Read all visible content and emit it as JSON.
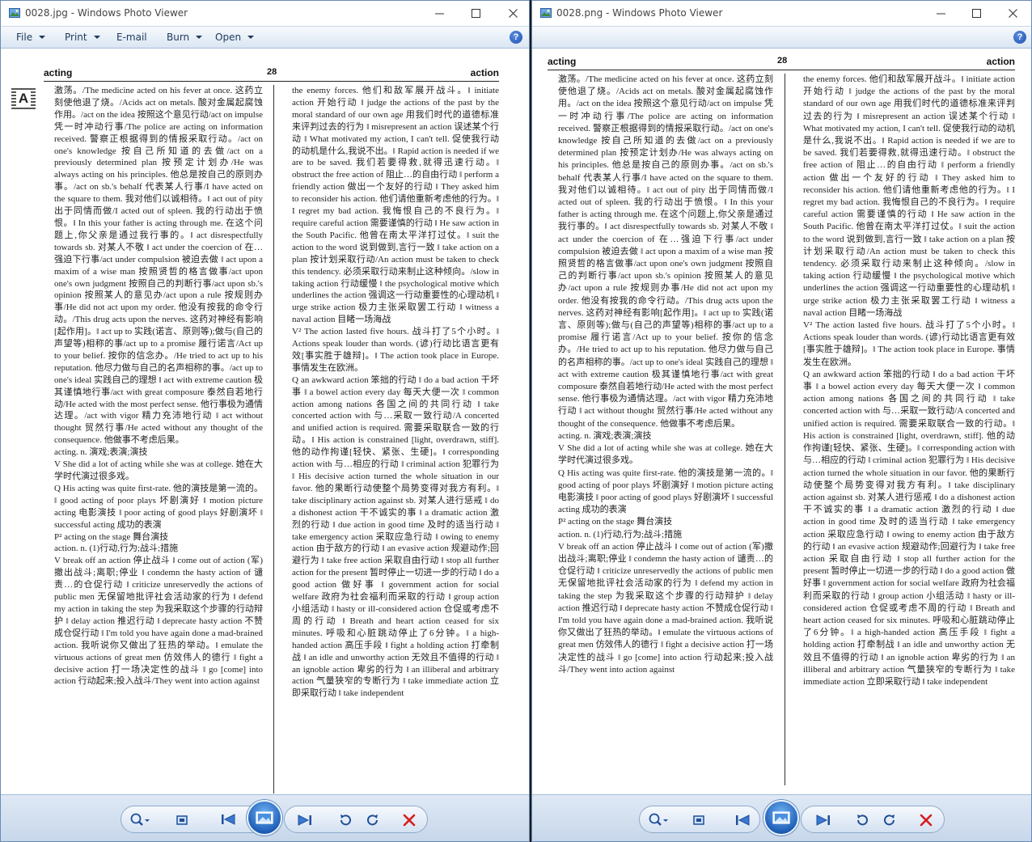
{
  "menu": {
    "file": "File",
    "print": "Print",
    "email": "E-mail",
    "burn": "Burn",
    "open": "Open",
    "help_glyph": "?"
  },
  "icons": {
    "app": "photo-viewer-icon",
    "minimize": "minimize-icon",
    "maximize": "maximize-icon",
    "close": "close-icon",
    "help": "help-icon",
    "zoom": "zoom-icon",
    "actual_size": "actual-size-icon",
    "previous": "previous-icon",
    "slideshow": "slideshow-icon",
    "next": "next-icon",
    "rotate_ccw": "rotate-counterclockwise-icon",
    "rotate_cw": "rotate-clockwise-icon",
    "delete": "delete-icon"
  },
  "colors": {
    "window_border": "#6b8bb3",
    "toolbar_text": "#1e395b",
    "accent_blue": "#1f5fb8",
    "delete_red": "#d42020",
    "taskbar": "#1a1a1a"
  },
  "windows": [
    {
      "title": "0028.jpg - Windows Photo Viewer",
      "page": {
        "header_left": "acting",
        "header_number": "28",
        "header_right": "action",
        "letter_marker": "A",
        "col1": "激荡。/The medicine acted on his fever at once. 这药立刻使他退了烧。/Acids act on metals. 酸对金属起腐蚀作用。/act on the idea 按照这个意见行动/act on impulse 凭一时冲动行事/The police are acting on information received. 警察正根据得到的情报采取行动。/act on one's knowledge 按自己所知道的去做/act on a previously determined plan 按预定计划办/He was always acting on his principles. 他总是按自己的原则办事。/act on sb.'s behalf 代表某人行事/I have acted on the square to them. 我对他们以诚相待。‖ act out of pity 出于同情而做/I acted out of spleen. 我的行动出于愤恨。‖ In this your father is acting through me. 在这个问题上,你父亲是通过我行事的。‖ act disrespectfully towards sb. 对某人不敬 ‖ act under the coercion of 在…强迫下行事/act under compulsion 被迫去做 ‖ act upon a maxim of a wise man 按照贤哲的格言做事/act upon one's own judgment 按照自己的判断行事/act upon sb.'s opinion 按照某人的意见办/act upon a rule 按规则办事/He did not act upon my order. 他没有按我的命令行动。/This drug acts upon the nerves. 这药对神经有影响[起作用]。‖ act up to 实践(诺言、原则等);做与(自己的声望等)相称的事/act up to a promise 履行诺言/Act up to your belief. 按你的信念办。/He tried to act up to his reputation. 他尽力做与自己的名声相称的事。/act up to one's ideal 实践自己的理想 ‖ act with extreme caution 极其谨慎地行事/act with great composure 泰然自若地行动/He acted with the most perfect sense. 他行事极为通情达理。/act with vigor 精力充沛地行动 ‖ act without thought 贸然行事/He acted without any thought of the consequence. 他做事不考虑后果。\nacting. n. 演戏;表演;演技\nV  She did a lot of acting while she was at college. 她在大学时代演过很多戏。\nQ  His acting was quite first-rate. 他的演技是第一流的。‖ good acting of poor plays 坏剧演好 ‖ motion picture acting 电影演技 ‖ poor acting of good plays 好剧演坏 ‖ successful acting 成功的表演\nP²  acting on the stage 舞台演技\naction. n. (1)行动,行为;战斗;措施\nV  break off an action 停止战斗 ‖ come out of action (军)撤出战斗;离职;停业 ‖ condemn the hasty action of 谴责…的仓促行动 ‖ criticize unreservedly the actions of public men 无保留地批评社会活动家的行为 ‖ defend my action in taking the step 为我采取这个步骤的行动辩护 ‖ delay action 推迟行动 ‖ deprecate hasty action 不赞成仓促行动 ‖ I'm told you have again done a mad-brained action. 我听说你又做出了狂热的举动。‖ emulate the virtuous actions of great men 仿效伟人的德行 ‖ fight a decisive action 打一场决定性的战斗 ‖ go [come] into action 行动起来;投入战斗/They went into action against",
        "col2": "the enemy forces. 他们和敌军展开战斗。‖ initiate action 开始行动 ‖ judge the actions of the past by the moral standard of our own age 用我们时代的道德标准来评判过去的行为 ‖ misrepresent an action 误述某个行动 ‖ What motivated my action, I can't tell. 促使我行动的动机是什么,我说不出。‖ Rapid action is needed if we are to be saved. 我们若要得救,就得迅速行动。‖ obstruct the free action of 阻止…的自由行动 ‖ perform a friendly action 做出一个友好的行动 ‖ They asked him to reconsider his action. 他们请他重新考虑他的行为。‖ I regret my bad action. 我悔恨自己的不良行为。‖ require careful action 需要谨慎的行动 ‖ He saw action in the South Pacific. 他曾在南太平洋打过仗。‖ suit the action to the word 说到做到,言行一致 ‖ take action on a plan 按计划采取行动/An action must be taken to check this tendency. 必须采取行动来制止这种倾向。/slow in taking action 行动缓慢 ‖ the psychological motive which underlines the action 强调这一行动重要性的心理动机 ‖ urge strike action 极力主张采取罢工行动 ‖ witness a naval action 目睹一场海战\nV²  The action lasted five hours. 战斗打了5个小时。‖ Actions speak louder than words. (谚)行动比语言更有效[事实胜于雄辩]。‖ The action took place in Europe. 事情发生在欧洲。\nQ  an awkward action 笨拙的行动 ‖ do a bad action 干坏事 ‖ a bowel action every day 每天大便一次 ‖ common action among nations 各国之间的共同行动 ‖ take concerted action with 与…采取一致行动/A concerted and unified action is required. 需要采取联合一致的行动。‖ His action is constrained [light, overdrawn, stiff]. 他的动作拘谨[轻快、紧张、生硬]。‖ corresponding action with 与…相应的行动 ‖ criminal action 犯罪行为 ‖ His decisive action turned the whole situation in our favor. 他的果断行动使整个局势变得对我方有利。‖ take disciplinary action against sb. 对某人进行惩戒 ‖ do a dishonest action 干不诚实的事 ‖ a dramatic action 激烈的行动 ‖ due action in good time 及时的适当行动 ‖ take emergency action 采取应急行动 ‖ owing to enemy action 由于敌方的行动 ‖ an evasive action 规避动作;回避行为 ‖ take free action 采取自由行动 ‖ stop all further action for the present 暂时停止一切进一步的行动 ‖ do a good action 做好事 ‖ government action for social welfare 政府为社会福利而采取的行动 ‖ group action 小组活动 ‖ hasty or ill-considered action 仓促或考虑不周的行动 ‖ Breath and heart action ceased for six minutes. 呼吸和心脏跳动停止了6分钟。‖ a high-handed action 高压手段 ‖ fight a holding action 打牵制战 ‖ an idle and unworthy action 无效且不值得的行动 ‖ an ignoble action 卑劣的行为 ‖ an illiberal and arbitrary action 气量狭窄的专断行为 ‖ take immediate action 立即采取行动 ‖ take independent"
      }
    },
    {
      "title": "0028.png - Windows Photo Viewer",
      "page": {
        "header_left": "acting",
        "header_number": "28",
        "header_right": "action"
      }
    }
  ]
}
